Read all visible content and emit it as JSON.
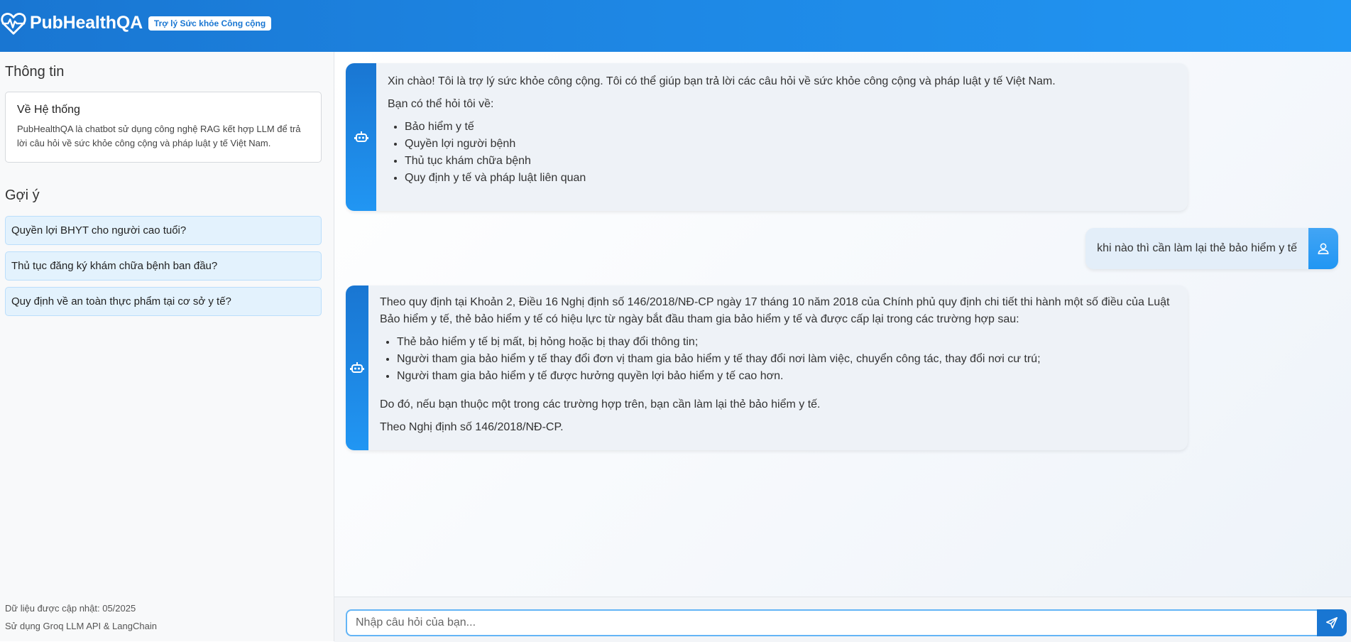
{
  "header": {
    "app_title": "PubHealthQA",
    "badge": "Trợ lý Sức khỏe Công cộng",
    "logo_icon": "heart-pulse-icon"
  },
  "sidebar": {
    "info_title": "Thông tin",
    "about_card": {
      "title": "Về Hệ thống",
      "text": "PubHealthQA là chatbot sử dụng công nghệ RAG kết hợp LLM để trả lời câu hỏi về sức khỏe công cộng và pháp luật y tế Việt Nam."
    },
    "suggestions_title": "Gợi ý",
    "suggestions": [
      "Quyền lợi BHYT cho người cao tuổi?",
      "Thủ tục đăng ký khám chữa bệnh ban đầu?",
      "Quy định về an toàn thực phẩm tại cơ sở y tế?"
    ],
    "footer": {
      "updated": "Dữ liệu được cập nhật: 05/2025",
      "powered": "Sử dụng Groq LLM API & LangChain"
    }
  },
  "chat": {
    "messages": [
      {
        "role": "bot",
        "icon": "robot-icon",
        "paragraph1": "Xin chào! Tôi là trợ lý sức khỏe công cộng. Tôi có thể giúp bạn trả lời các câu hỏi về sức khỏe công cộng và pháp luật y tế Việt Nam.",
        "paragraph2": "Bạn có thể hỏi tôi về:",
        "items": [
          "Bảo hiểm y tế",
          "Quyền lợi người bệnh",
          "Thủ tục khám chữa bệnh",
          "Quy định y tế và pháp luật liên quan"
        ]
      },
      {
        "role": "user",
        "icon": "user-icon",
        "text": "khi nào thì cần làm lại thẻ bảo hiểm y tế"
      },
      {
        "role": "bot",
        "icon": "robot-icon",
        "paragraph1": "Theo quy định tại Khoản 2, Điều 16 Nghị định số 146/2018/NĐ-CP ngày 17 tháng 10 năm 2018 của Chính phủ quy định chi tiết thi hành một số điều của Luật Bảo hiểm y tế, thẻ bảo hiểm y tế có hiệu lực từ ngày bắt đầu tham gia bảo hiểm y tế và được cấp lại trong các trường hợp sau:",
        "items": [
          "Thẻ bảo hiểm y tế bị mất, bị hỏng hoặc bị thay đổi thông tin;",
          "Người tham gia bảo hiểm y tế thay đổi đơn vị tham gia bảo hiểm y tế thay đổi nơi làm việc, chuyển công tác, thay đổi nơi cư trú;",
          "Người tham gia bảo hiểm y tế được hưởng quyền lợi bảo hiểm y tế cao hơn."
        ],
        "paragraph2": "Do đó, nếu bạn thuộc một trong các trường hợp trên, bạn cần làm lại thẻ bảo hiểm y tế.",
        "paragraph3": "Theo Nghị định số 146/2018/NĐ-CP."
      }
    ]
  },
  "input": {
    "placeholder": "Nhập câu hỏi của bạn...",
    "send_icon": "send-icon"
  },
  "colors": {
    "primary": "#1976d2",
    "accent": "#2196f3",
    "suggestion_bg": "#e3f2fd"
  }
}
